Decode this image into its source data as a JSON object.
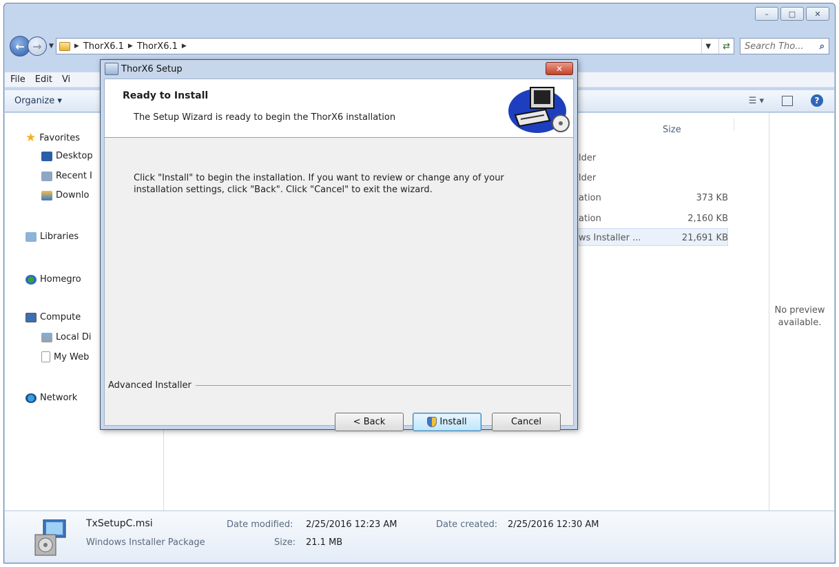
{
  "explorer": {
    "caption_buttons": [
      "–",
      "□",
      "✕"
    ],
    "breadcrumbs": [
      "ThorX6.1",
      "ThorX6.1"
    ],
    "search_placeholder": "Search Tho...",
    "menu": [
      "File",
      "Edit",
      "Vi"
    ],
    "organize_label": "Organize ▾",
    "nav": {
      "favorites": "Favorites",
      "desktop": "Desktop",
      "recent": "Recent I",
      "downloads": "Downlo",
      "libraries": "Libraries",
      "homegroup": "Homegro",
      "computer": "Compute",
      "local_disk": "Local Di",
      "my_web": "My Web",
      "network": "Network"
    },
    "columns": {
      "size": "Size"
    },
    "rows": [
      {
        "type": "lder",
        "size": ""
      },
      {
        "type": "lder",
        "size": ""
      },
      {
        "type": "ation",
        "size": "373 KB"
      },
      {
        "type": "ation",
        "size": "2,160 KB"
      },
      {
        "type": "ws Installer ...",
        "size": "21,691 KB"
      }
    ],
    "preview_text": "No preview available.",
    "details": {
      "filename": "TxSetupC.msi",
      "filetype": "Windows Installer Package",
      "date_modified_label": "Date modified:",
      "date_modified": "2/25/2016 12:23 AM",
      "date_created_label": "Date created:",
      "date_created": "2/25/2016 12:30 AM",
      "size_label": "Size:",
      "size": "21.1 MB"
    }
  },
  "dialog": {
    "title": "ThorX6 Setup",
    "close_label": "✕",
    "heading": "Ready to Install",
    "subtitle": "The Setup Wizard is ready to begin the ThorX6 installation",
    "message_line1": "Click \"Install\" to begin the installation.  If you want to review or change any of your",
    "message_line2": "installation settings, click \"Back\".  Click \"Cancel\" to exit the wizard.",
    "brand": "Advanced Installer",
    "buttons": {
      "back": "< Back",
      "install": "Install",
      "cancel": "Cancel"
    }
  },
  "colors": {
    "accent": "#2f66b8",
    "window_frame": "#c4d6ee",
    "close_red": "#c3432c"
  }
}
